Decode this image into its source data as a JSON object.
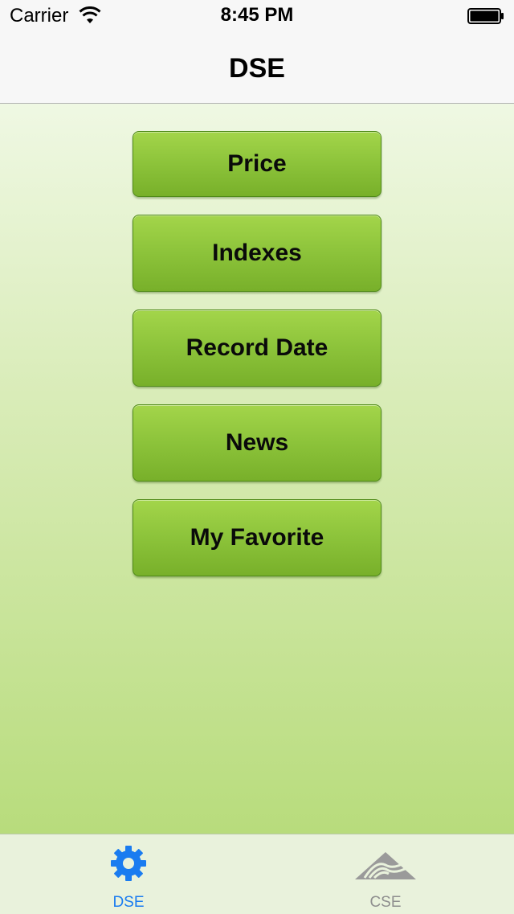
{
  "status_bar": {
    "carrier": "Carrier",
    "time": "8:45 PM",
    "wifi_icon": "wifi-icon",
    "battery_icon": "battery-icon"
  },
  "nav": {
    "title": "DSE"
  },
  "menu": {
    "buttons": [
      {
        "label": "Price"
      },
      {
        "label": "Indexes"
      },
      {
        "label": "Record Date"
      },
      {
        "label": "News"
      },
      {
        "label": "My Favorite"
      }
    ]
  },
  "tab_bar": {
    "tabs": [
      {
        "label": "DSE",
        "icon": "gear-icon",
        "selected": true,
        "color": "#1a7cf0"
      },
      {
        "label": "CSE",
        "icon": "cse-logo-icon",
        "selected": false,
        "color": "#8e8e8e"
      }
    ]
  },
  "colors": {
    "accent": "#1a7cf0",
    "button_green": "#8cc33a"
  }
}
